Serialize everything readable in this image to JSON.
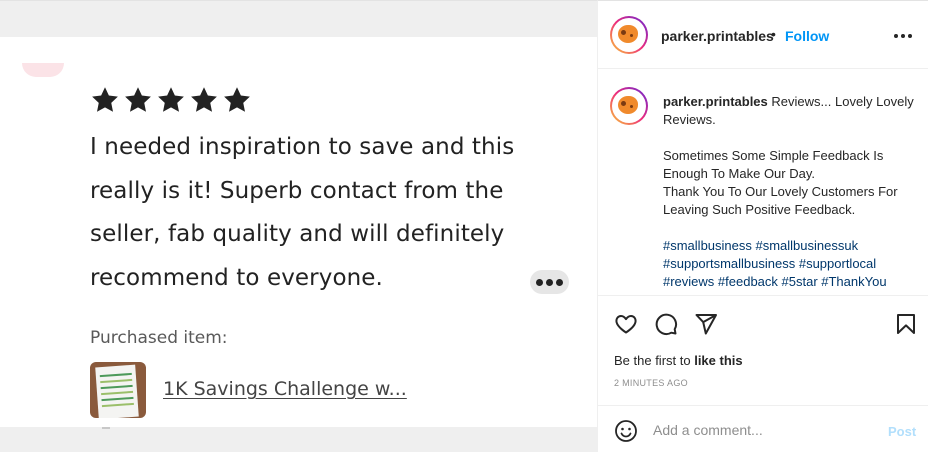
{
  "review": {
    "star_count": 5,
    "text": "I needed inspiration to save and this really is it! Superb contact from the seller, fab quality and will definitely recommend to everyone.",
    "purchased_label": "Purchased item:",
    "product_title": "1K Savings Challenge w..."
  },
  "post": {
    "header": {
      "username": "parker.printables",
      "separator": "•",
      "follow_label": "Follow"
    },
    "caption": {
      "username": "parker.printables",
      "line1": "Reviews... Lovely Lovely Reviews.",
      "line2": "Sometimes Some Simple Feedback Is Enough To Make Our Day.",
      "line3": "Thank You To Our Lovely Customers For Leaving Such Positive Feedback.",
      "hashtags": "#smallbusiness #smallbusinessuk #supportsmallbusiness #supportlocal #reviews #feedback #5star #ThankYou"
    },
    "likes": {
      "prefix": "Be the first to ",
      "action": "like this"
    },
    "timestamp": "2 MINUTES AGO",
    "comment": {
      "placeholder": "Add a comment...",
      "post_label": "Post"
    }
  },
  "colors": {
    "follow": "#0095f6",
    "post_disabled": "#b2dffc",
    "hashtag": "#00376b",
    "star": "#222222"
  },
  "icons": [
    "star-icon",
    "more-icon",
    "heart-icon",
    "comment-icon",
    "share-icon",
    "bookmark-icon",
    "emoji-icon"
  ]
}
